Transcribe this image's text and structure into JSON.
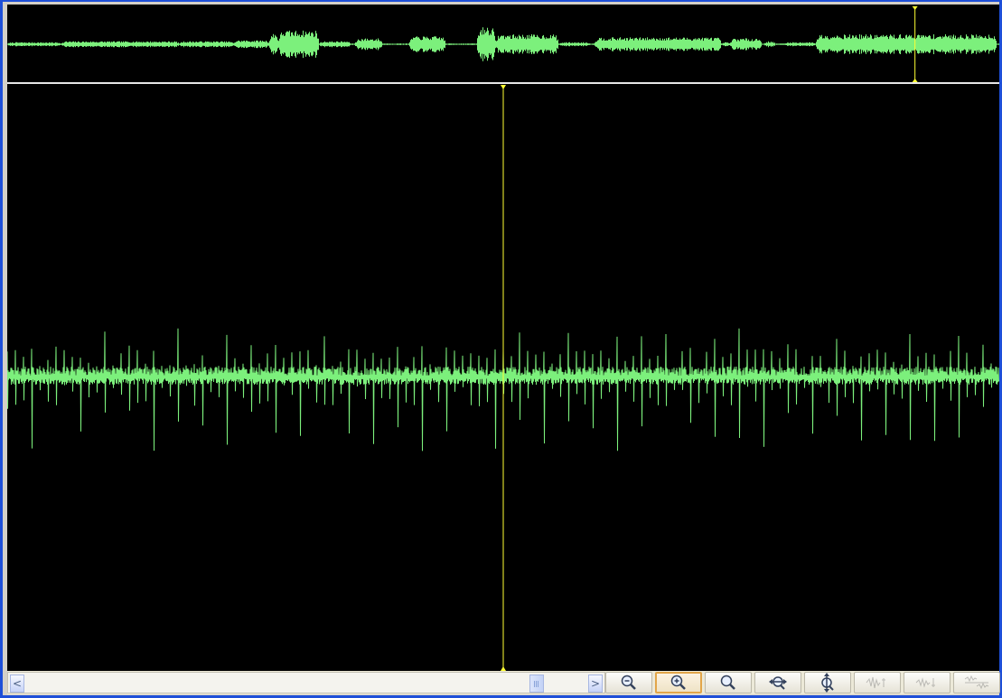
{
  "colors": {
    "background": "#000000",
    "waveform": "#7cf07c",
    "cursor": "#ffff33",
    "divider": "#e6e6e6",
    "window_border": "#1e4fd8"
  },
  "overview": {
    "cursor_position_fraction": 0.915
  },
  "detail": {
    "cursor_position_fraction": 0.5
  },
  "scrollbar": {
    "left_arrow": "<",
    "right_arrow": ">",
    "thumb_position_fraction": 0.895
  },
  "toolbar": {
    "buttons": [
      {
        "name": "zoom-out-button",
        "icon": "magnifier-minus-icon",
        "state": "normal"
      },
      {
        "name": "zoom-in-button",
        "icon": "magnifier-plus-icon",
        "state": "active"
      },
      {
        "name": "zoom-selection-button",
        "icon": "magnifier-icon",
        "state": "normal"
      },
      {
        "name": "fit-horizontal-button",
        "icon": "horizontal-arrows-icon",
        "state": "normal"
      },
      {
        "name": "fit-vertical-button",
        "icon": "vertical-arrows-icon",
        "state": "normal"
      },
      {
        "name": "vertical-zoom-in-button",
        "icon": "waveform-expand-icon",
        "state": "disabled"
      },
      {
        "name": "vertical-zoom-out-button",
        "icon": "waveform-shrink-icon",
        "state": "disabled"
      },
      {
        "name": "split-waveform-button",
        "icon": "dual-waveform-icon",
        "state": "disabled"
      }
    ]
  }
}
